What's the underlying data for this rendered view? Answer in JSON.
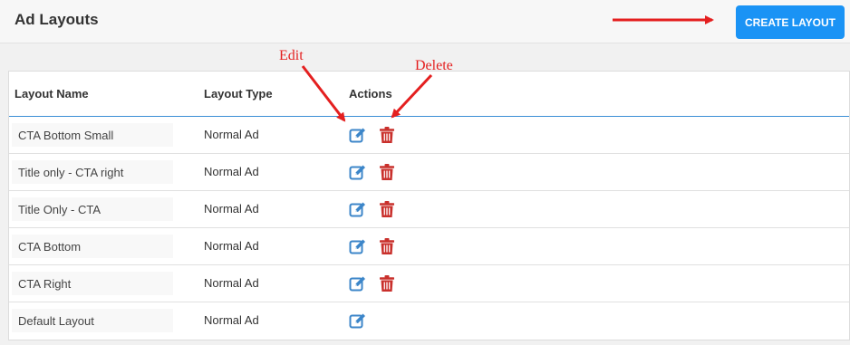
{
  "header": {
    "title": "Ad Layouts",
    "create_button_label": "CREATE LAYOUT"
  },
  "table": {
    "columns": [
      "Layout Name",
      "Layout Type",
      "Actions"
    ],
    "rows": [
      {
        "name": "CTA Bottom Small",
        "type": "Normal Ad",
        "actions": [
          "edit",
          "delete"
        ]
      },
      {
        "name": "Title only - CTA right",
        "type": "Normal Ad",
        "actions": [
          "edit",
          "delete"
        ]
      },
      {
        "name": "Title Only - CTA",
        "type": "Normal Ad",
        "actions": [
          "edit",
          "delete"
        ]
      },
      {
        "name": "CTA Bottom",
        "type": "Normal Ad",
        "actions": [
          "edit",
          "delete"
        ]
      },
      {
        "name": "CTA Right",
        "type": "Normal Ad",
        "actions": [
          "edit",
          "delete"
        ]
      },
      {
        "name": "Default Layout",
        "type": "Normal Ad",
        "actions": [
          "edit"
        ]
      }
    ]
  },
  "annotations": {
    "edit_label": "Edit",
    "delete_label": "Delete"
  },
  "icons": {
    "edit": "edit-icon",
    "delete": "trash-icon"
  },
  "colors": {
    "accent": "#1a93f5",
    "edit_icon": "#3c86c9",
    "delete_icon": "#c9302c",
    "annotation": "#e41f1f",
    "header_rule": "#3a8ed6"
  }
}
